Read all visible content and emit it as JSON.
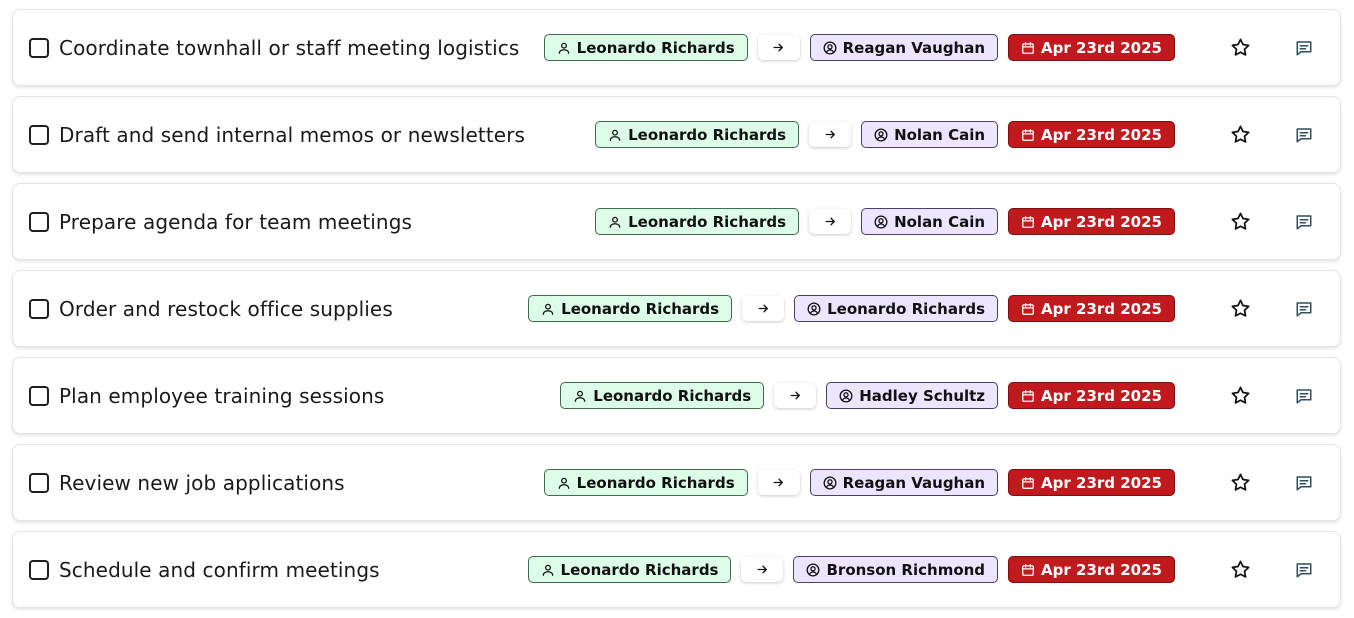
{
  "colors": {
    "creator_chip_bg": "#dcfce7",
    "assignee_chip_bg": "#ede4ff",
    "date_chip_bg": "#c0191e",
    "comment_icon": "#2f4f5f"
  },
  "icons": {
    "creator": "user-icon",
    "arrow": "arrow-right-icon",
    "assignee": "user-circle-icon",
    "date": "calendar-icon",
    "star": "star-icon",
    "comment": "comment-icon"
  },
  "tasks": [
    {
      "title": "Coordinate townhall or staff meeting logistics",
      "creator": "Leonardo Richards",
      "assignee": "Reagan Vaughan",
      "due": "Apr 23rd 2025"
    },
    {
      "title": "Draft and send internal memos or newsletters",
      "creator": "Leonardo Richards",
      "assignee": "Nolan Cain",
      "due": "Apr 23rd 2025"
    },
    {
      "title": "Prepare agenda for team meetings",
      "creator": "Leonardo Richards",
      "assignee": "Nolan Cain",
      "due": "Apr 23rd 2025"
    },
    {
      "title": "Order and restock office supplies",
      "creator": "Leonardo Richards",
      "assignee": "Leonardo Richards",
      "due": "Apr 23rd 2025"
    },
    {
      "title": "Plan employee training sessions",
      "creator": "Leonardo Richards",
      "assignee": "Hadley Schultz",
      "due": "Apr 23rd 2025"
    },
    {
      "title": "Review new job applications",
      "creator": "Leonardo Richards",
      "assignee": "Reagan Vaughan",
      "due": "Apr 23rd 2025"
    },
    {
      "title": "Schedule and confirm meetings",
      "creator": "Leonardo Richards",
      "assignee": "Bronson Richmond",
      "due": "Apr 23rd 2025"
    }
  ]
}
